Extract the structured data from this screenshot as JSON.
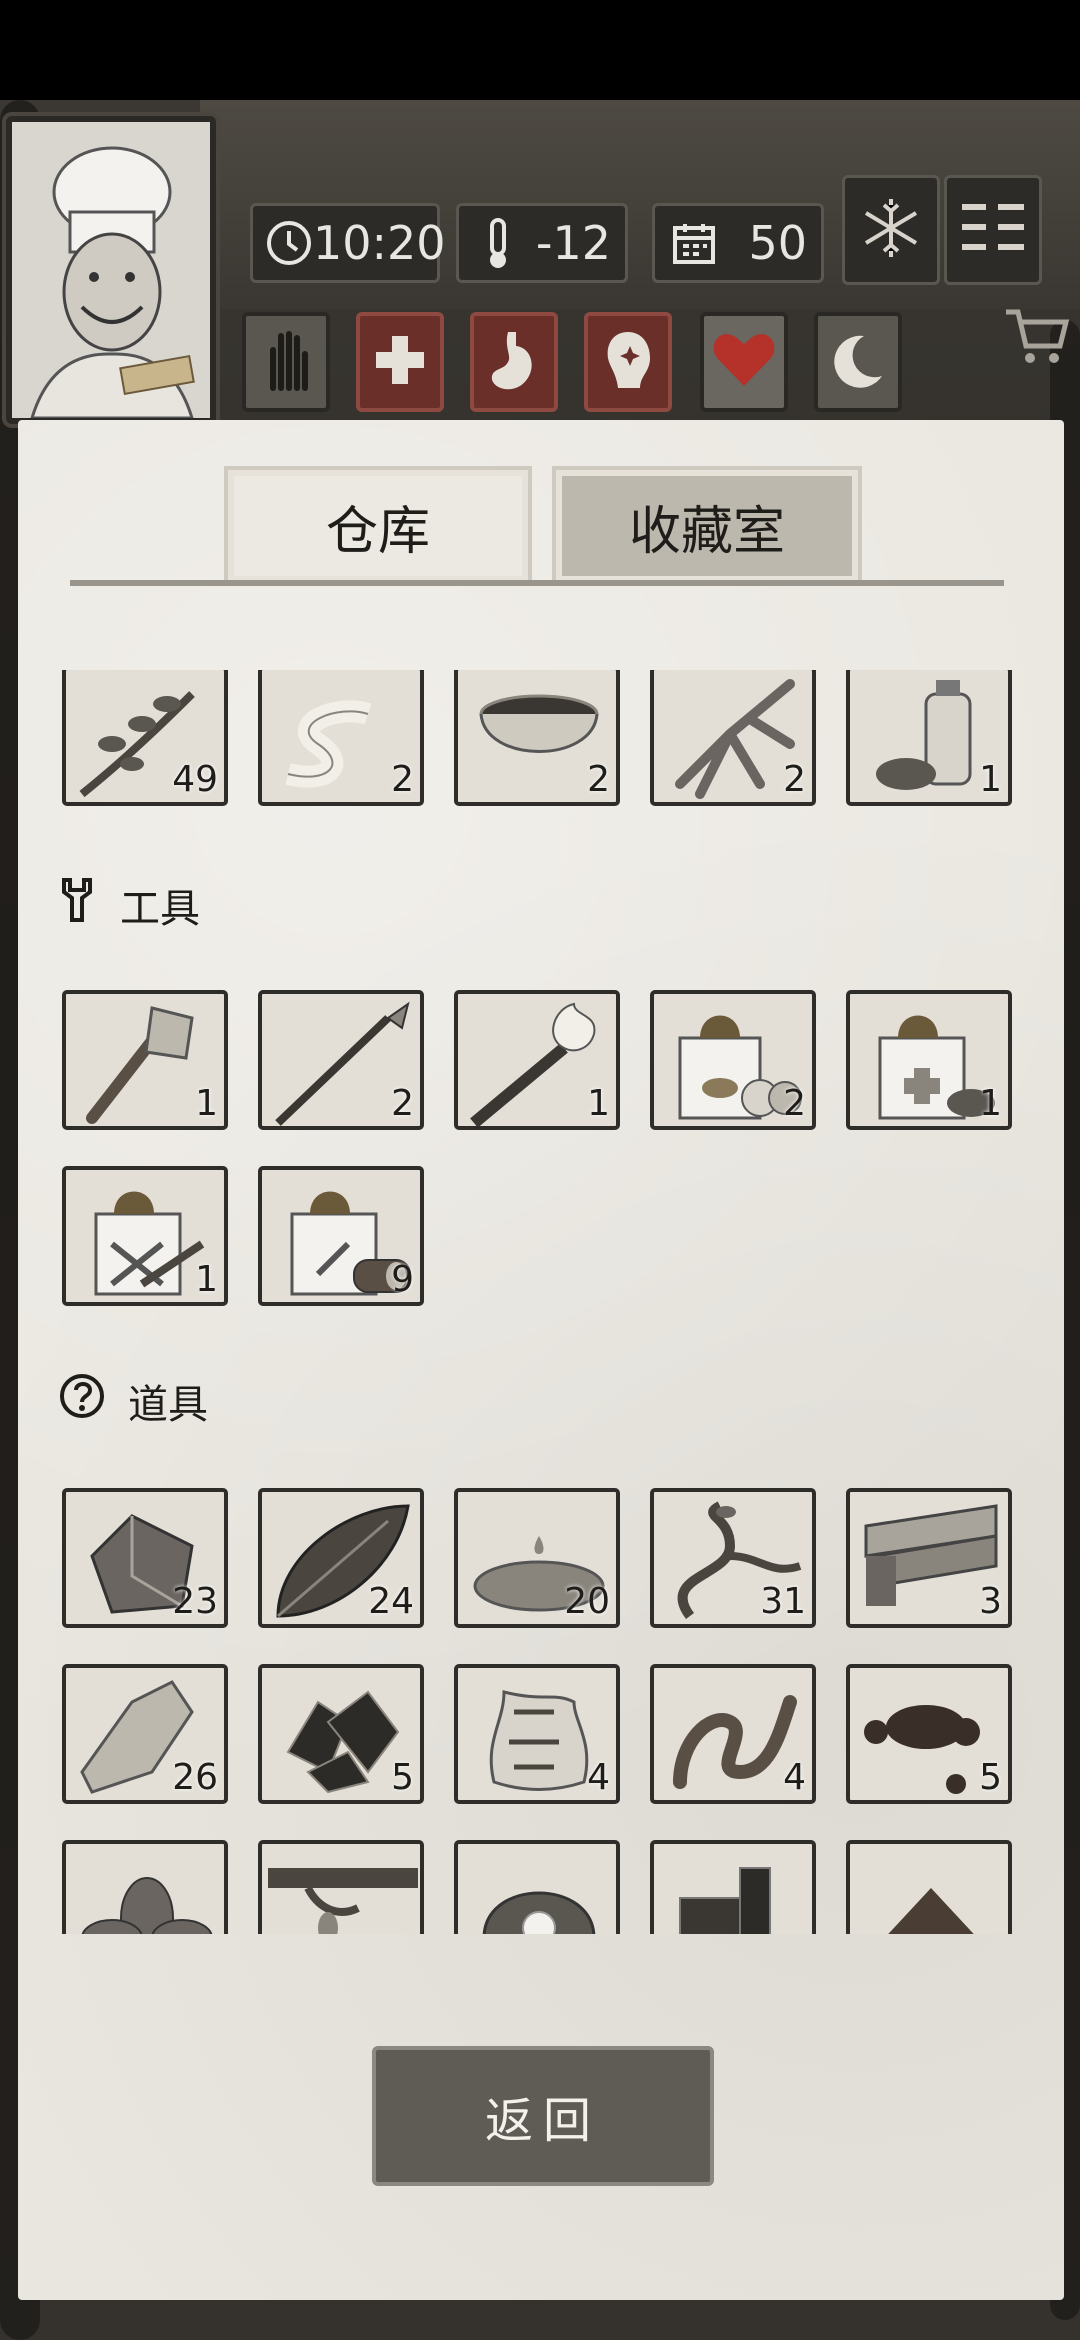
{
  "top_bar": {
    "time": "10:20",
    "temperature": "-12",
    "days": "50",
    "colors": {
      "wood": "#3e3b36",
      "paper": "#e9e6df",
      "heart": "#b5322a"
    }
  },
  "icons": {
    "stats": [
      "clock-icon",
      "thermometer-icon",
      "calendar-icon"
    ],
    "buttons": [
      "snowflake-icon",
      "menu-icon"
    ],
    "status": [
      "hand-icon",
      "health-cross-icon",
      "stomach-icon",
      "mind-icon",
      "heart-icon",
      "sleep-moon-icon"
    ],
    "cart": "cart-icon"
  },
  "tabs": [
    {
      "label": "仓库",
      "active": true
    },
    {
      "label": "收藏室",
      "active": false
    }
  ],
  "inventory": {
    "partial_row": [
      {
        "item": "herb-branch",
        "count": "49"
      },
      {
        "item": "bandage",
        "count": "2"
      },
      {
        "item": "bowl-soup",
        "count": "2"
      },
      {
        "item": "ginseng-root",
        "count": "2"
      },
      {
        "item": "bottle-herb",
        "count": "1"
      }
    ],
    "tools_title": "工具",
    "tools": [
      {
        "item": "stone-axe",
        "count": "1"
      },
      {
        "item": "spear",
        "count": "2"
      },
      {
        "item": "torch",
        "count": "1"
      },
      {
        "item": "food-gift-box",
        "count": "2"
      },
      {
        "item": "medical-gift-box",
        "count": "1"
      },
      {
        "item": "tool-gift-box",
        "count": "1"
      },
      {
        "item": "wood-gift-box",
        "count": "9"
      }
    ],
    "props_title": "道具",
    "props": [
      {
        "item": "stone",
        "count": "23"
      },
      {
        "item": "leaf",
        "count": "24"
      },
      {
        "item": "water-puddle",
        "count": "20"
      },
      {
        "item": "vine",
        "count": "31"
      },
      {
        "item": "planks",
        "count": "3"
      },
      {
        "item": "flint",
        "count": "26"
      },
      {
        "item": "coal",
        "count": "5"
      },
      {
        "item": "animal-hide",
        "count": "4"
      },
      {
        "item": "worm",
        "count": "4"
      },
      {
        "item": "resin",
        "count": "5"
      },
      {
        "item": "herb-leaves",
        "count": ""
      },
      {
        "item": "tree-branch",
        "count": ""
      },
      {
        "item": "pearl-shell",
        "count": ""
      },
      {
        "item": "iron-scrap",
        "count": ""
      },
      {
        "item": "soil-pile",
        "count": ""
      }
    ]
  },
  "back_button": "返回"
}
